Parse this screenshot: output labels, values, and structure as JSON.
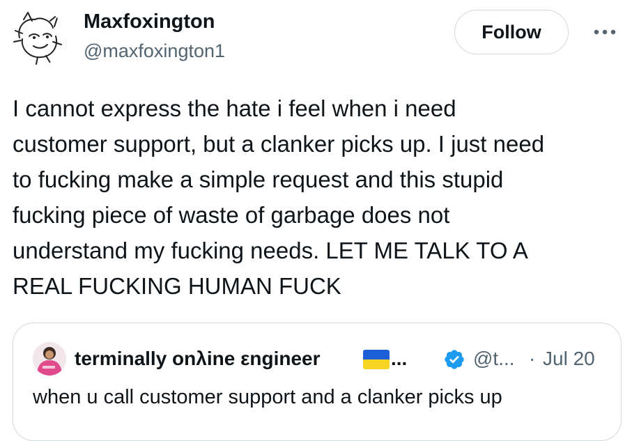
{
  "tweet": {
    "author": {
      "display_name": "Maxfoxington",
      "handle": "@maxfoxington1",
      "avatar_icon": "sketch-character-avatar"
    },
    "follow_label": "Follow",
    "more_icon": "more-dots-icon",
    "text": "I cannot express the hate i feel when i need\ncustomer support, but a clanker picks up. I just need\nto fucking make a simple request and this stupid\nfucking piece of waste of garbage does not\nunderstand my fucking needs. LET ME TALK TO A\nREAL FUCKING HUMAN FUCK"
  },
  "quote": {
    "display_name": "terminally onλine εngineer",
    "flag_icon": "ukraine-flag-icon",
    "name_ellipsis": "...",
    "verified_icon": "verified-badge-icon",
    "handle": "@t...",
    "dot": "·",
    "date": "Jul 20",
    "text": "when u call customer support and a clanker picks up"
  },
  "colors": {
    "text_primary": "#0f1419",
    "text_secondary": "#536471",
    "border": "#cfd9de",
    "verified_blue": "#1d9bf0",
    "flag_blue": "#1c5fd6",
    "flag_yellow": "#f7d322"
  }
}
